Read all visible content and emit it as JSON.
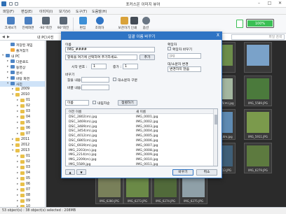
{
  "window": {
    "title": "포커스온 이미지 뷰어"
  },
  "menu": [
    "파일(F)",
    "편집(E)",
    "이미지(I)",
    "보기(V)",
    "도구(T)",
    "도움말(H)"
  ],
  "toolbar": {
    "items": [
      {
        "label": "크게보기",
        "icon": "zoom-fit-icon",
        "color": "#4a7fc1"
      },
      {
        "label": "전체화면",
        "icon": "fullscreen-icon",
        "color": "#4a7fc1"
      },
      {
        "label": "-90°회전",
        "icon": "rotate-left-icon",
        "color": "#5a6775"
      },
      {
        "label": "90°회전",
        "icon": "rotate-right-icon",
        "color": "#5a6775"
      },
      {
        "label": "편집",
        "icon": "edit-icon",
        "color": "#3d8fd6"
      },
      {
        "label": "조회하",
        "icon": "search-icon",
        "color": "#2f74c4"
      },
      {
        "label": "보관하기",
        "icon": "archive-icon",
        "color": "#d9a23a"
      },
      {
        "label": "인쇄",
        "icon": "print-icon",
        "color": "#444c56"
      },
      {
        "label": "옵션",
        "icon": "gear-icon",
        "color": "#6a7684"
      }
    ],
    "battery": {
      "value": "100%",
      "level": 100,
      "color": "#3bbf55"
    }
  },
  "path": {
    "crumbs": "내 PC\\사진",
    "search_placeholder": "파일 검색"
  },
  "sidebar": {
    "items": [
      {
        "label": "저장된 게임",
        "indent": 1,
        "expand": "",
        "icon": "blue"
      },
      {
        "label": "즐겨찾기",
        "indent": 1,
        "expand": "",
        "icon": "star"
      },
      {
        "label": "내 PC",
        "indent": 0,
        "expand": "v",
        "icon": "blue"
      },
      {
        "label": "다운로드",
        "indent": 1,
        "expand": ">",
        "icon": "blue"
      },
      {
        "label": "동영상",
        "indent": 1,
        "expand": ">",
        "icon": "blue"
      },
      {
        "label": "문서",
        "indent": 1,
        "expand": ">",
        "icon": "blue"
      },
      {
        "label": "바탕 화면",
        "indent": 1,
        "expand": ">",
        "icon": "blue"
      },
      {
        "label": "사진",
        "indent": 1,
        "expand": "v",
        "icon": "blue",
        "selected": true
      },
      {
        "label": "2009",
        "indent": 2,
        "expand": ">",
        "icon": "folder"
      },
      {
        "label": "2010",
        "indent": 2,
        "expand": "v",
        "icon": "folder"
      },
      {
        "label": "01",
        "indent": 3,
        "expand": ">",
        "icon": "folder"
      },
      {
        "label": "02",
        "indent": 3,
        "expand": ">",
        "icon": "folder"
      },
      {
        "label": "03",
        "indent": 3,
        "expand": ">",
        "icon": "folder"
      },
      {
        "label": "04",
        "indent": 3,
        "expand": ">",
        "icon": "folder"
      },
      {
        "label": "05",
        "indent": 3,
        "expand": ">",
        "icon": "folder"
      },
      {
        "label": "06",
        "indent": 3,
        "expand": ">",
        "icon": "folder"
      },
      {
        "label": "07",
        "indent": 3,
        "expand": ">",
        "icon": "folder"
      },
      {
        "label": "2011",
        "indent": 2,
        "expand": ">",
        "icon": "folder"
      },
      {
        "label": "2012",
        "indent": 2,
        "expand": ">",
        "icon": "folder"
      },
      {
        "label": "2013",
        "indent": 2,
        "expand": "v",
        "icon": "folder"
      },
      {
        "label": "01",
        "indent": 3,
        "expand": ">",
        "icon": "folder"
      },
      {
        "label": "02",
        "indent": 3,
        "expand": ">",
        "icon": "folder"
      },
      {
        "label": "03",
        "indent": 3,
        "expand": ">",
        "icon": "folder"
      },
      {
        "label": "04",
        "indent": 3,
        "expand": ">",
        "icon": "folder"
      },
      {
        "label": "05",
        "indent": 3,
        "expand": ">",
        "icon": "folder"
      },
      {
        "label": "06",
        "indent": 3,
        "expand": ">",
        "icon": "folder"
      },
      {
        "label": "07",
        "indent": 3,
        "expand": ">",
        "icon": "folder"
      },
      {
        "label": "08",
        "indent": 3,
        "expand": ">",
        "icon": "folder"
      },
      {
        "label": "09",
        "indent": 3,
        "expand": ">",
        "icon": "folder"
      },
      {
        "label": "10",
        "indent": 3,
        "expand": ">",
        "icon": "folder"
      }
    ]
  },
  "thumbnails": [
    {
      "caption": "",
      "color": "#6d8e4b"
    },
    {
      "caption": "",
      "color": "#7aa2c9"
    },
    {
      "caption": "DSC_6865(m).jpg",
      "color": "#a4b7a0"
    },
    {
      "caption": "IMG_2214m.jpg",
      "color": "#5f8bb3"
    },
    {
      "caption": "IMG_5589.JPG",
      "color": "#4b7a3c"
    },
    {
      "caption": "IMG_5911.JPG",
      "color": "#7b9a4c"
    },
    {
      "caption": "IMG_5913.JPG",
      "color": "#3f5f78"
    },
    {
      "caption": "IMG_6280.JPG",
      "color": "#79805a"
    },
    {
      "caption": "IMG_6273.JPG",
      "color": "#6b8a47"
    },
    {
      "caption": "IMG_6274.JPG",
      "color": "#516a3a"
    },
    {
      "caption": "IMG_6275.JPG",
      "color": "#8fa0a8"
    },
    {
      "caption": "IMG_6279.JPG",
      "color": "#5d7a3f"
    }
  ],
  "status": "53 object(s) : 38 object(s) selected : 208MB",
  "dialog": {
    "title": "일괄 이름 바꾸기",
    "close": "X",
    "name_label": "이름",
    "name_value": "IMG_####",
    "insert_combo": "항목을 여기에 선택하여 추가하세요.",
    "add_button": "추가",
    "start_label": "시작 번호 :",
    "start_value": "1",
    "step_label": "증가 :",
    "step_value": "1",
    "ext_label": "확장자",
    "ext_check": "확장자 바꾸기",
    "ext_value": "jpg",
    "case_label": "대/소문자 변경",
    "case_value": "변경하지 않음",
    "replace_label": "바꾸기",
    "find_label": "찾을 내용:",
    "replace_with_label": "바꿀 내용:",
    "case_sensitive": "대소문자 구분",
    "sort_value": "이름",
    "sort_desc": "내림차순",
    "sort_button": "정렬하기",
    "list_header_old": "이전 이름",
    "list_header_new": "새 이름",
    "rows": [
      {
        "old": "DSC_2802(m).jpg",
        "new": "IMG_0001.jpg"
      },
      {
        "old": "DSC_3469(m).jpg",
        "new": "IMG_0002.jpg"
      },
      {
        "old": "DSC_3489(m).jpg",
        "new": "IMG_0003.jpg"
      },
      {
        "old": "DSC_3454(m).jpg",
        "new": "IMG_0004.jpg"
      },
      {
        "old": "DSC_4012(m).jpg",
        "new": "IMG_0005.jpg"
      },
      {
        "old": "DSC_6865(m).jpg",
        "new": "IMG_0006.jpg"
      },
      {
        "old": "DSC_6939(m).jpg",
        "new": "IMG_0007.jpg"
      },
      {
        "old": "IMG_2203(m).jpg",
        "new": "IMG_0008.jpg"
      },
      {
        "old": "IMG_2214(m).jpg",
        "new": "IMG_0009.jpg"
      },
      {
        "old": "IMG_2209(m).jpg",
        "new": "IMG_0010.jpg"
      },
      {
        "old": "IMG_5589.jpg",
        "new": "IMG_0011.jpg"
      }
    ],
    "up": "▲",
    "down": "▼",
    "ok": "바꾸기",
    "cancel": "취소"
  }
}
